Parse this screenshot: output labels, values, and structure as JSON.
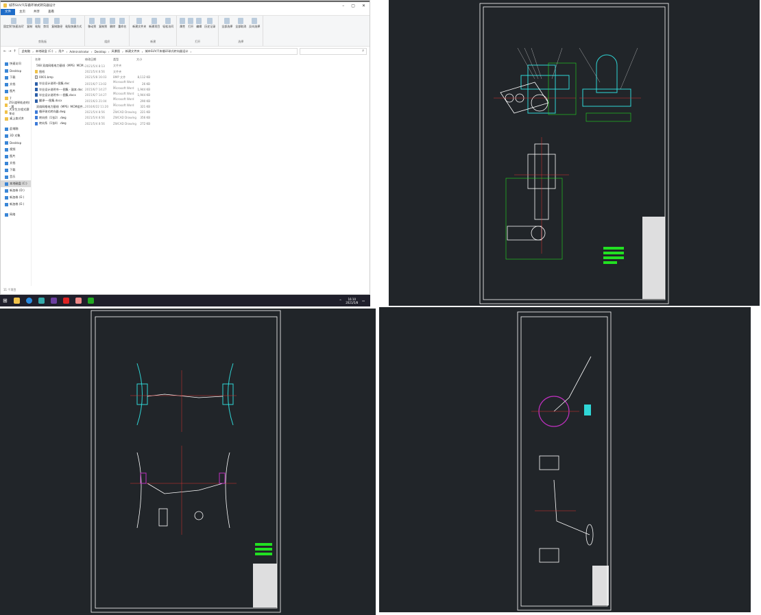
{
  "explorer": {
    "title": "城市SUV汽车循环球式转向器设计",
    "tabs": [
      "文件",
      "主页",
      "共享",
      "查看"
    ],
    "ribbon": {
      "groups": [
        {
          "label": "剪贴板",
          "items": [
            "固定到'快速访问'",
            "复制",
            "粘贴",
            "剪切",
            "复制路径",
            "粘贴快捷方式"
          ]
        },
        {
          "label": "组织",
          "items": [
            "移动到",
            "复制到",
            "删除",
            "重命名"
          ]
        },
        {
          "label": "新建",
          "items": [
            "新建文件夹",
            "新建项目",
            "轻松访问"
          ]
        },
        {
          "label": "打开",
          "items": [
            "属性",
            "打开",
            "编辑",
            "历史记录"
          ]
        },
        {
          "label": "选择",
          "items": [
            "全部选择",
            "全部取消",
            "反向选择"
          ]
        }
      ]
    },
    "breadcrumb": [
      "此电脑",
      "本地磁盘 (C:)",
      "用户",
      "Administrator",
      "Desktop",
      "风暴图",
      "新建文件夹",
      "城市SUV汽车循环球式转向器设计"
    ],
    "columns": [
      "名称",
      "修改日期",
      "类型",
      "大小"
    ],
    "files": [
      {
        "name": "568 双扇网格电力基线（MPS）MCM...",
        "date": "2021/5/4 8:13",
        "type": "文件夹",
        "size": "",
        "icon": "folder"
      },
      {
        "name": "图纸",
        "date": "2021/5/4 8:56",
        "type": "文件夹",
        "size": "",
        "icon": "folder"
      },
      {
        "name": "0001.bmp",
        "date": "2021/5/8 16:03",
        "type": "BMP 文件",
        "size": "8,112 KB",
        "icon": "bmp"
      },
      {
        "name": "毕业设计说明--图集.doc",
        "date": "2015/6/7 13:02",
        "type": "Microsoft Word ...",
        "size": "26 KB",
        "icon": "word"
      },
      {
        "name": "毕业设计说明书----图集 - 副本.doc",
        "date": "2015/6/7 14:27",
        "type": "Microsoft Word ...",
        "size": "1,944 KB",
        "icon": "word"
      },
      {
        "name": "毕业设计说明书----图集.docx",
        "date": "2015/6/7 14:27",
        "type": "Microsoft Word ...",
        "size": "1,944 KB",
        "icon": "word"
      },
      {
        "name": "翻译----图集.docx",
        "date": "2015/6/3 21:04",
        "type": "Microsoft Word ...",
        "size": "290 KB",
        "icon": "word"
      },
      {
        "name": "双扇网格电力基线（MPS）MCM组件...",
        "date": "2016/6/22 11:20",
        "type": "Microsoft Word ...",
        "size": "321 KB",
        "icon": "word"
      },
      {
        "name": "循环球式转向器.dwg",
        "date": "2021/5/4 8:56",
        "type": "ZWCAD Drawing",
        "size": "221 KB",
        "icon": "dwg"
      },
      {
        "name": "转向桥（1张2）.dwg",
        "date": "2021/5/4 8:56",
        "type": "ZWCAD Drawing",
        "size": "356 KB",
        "icon": "dwg"
      },
      {
        "name": "转向系（1张4）.dwg",
        "date": "2021/5/4 8:56",
        "type": "ZWCAD Drawing",
        "size": "272 KB",
        "icon": "dwg"
      }
    ],
    "nav": [
      {
        "label": "快速访问",
        "icon": "star"
      },
      {
        "label": "Desktop",
        "icon": "desktop"
      },
      {
        "label": "下载",
        "icon": "download"
      },
      {
        "label": "文档",
        "icon": "doc"
      },
      {
        "label": "图片",
        "icon": "picture"
      },
      {
        "label": "7",
        "icon": "folder"
      },
      {
        "label": "ZG(道琴轨迹的) - 满",
        "icon": "folder"
      },
      {
        "label": "大学生方程式赛车论",
        "icon": "folder"
      },
      {
        "label": "桌上查式木",
        "icon": "folder"
      },
      {
        "label": "此电脑",
        "icon": "pc"
      },
      {
        "label": "3D 对象",
        "icon": "3d"
      },
      {
        "label": "Desktop",
        "icon": "desktop"
      },
      {
        "label": "视频",
        "icon": "video"
      },
      {
        "label": "图片",
        "icon": "picture"
      },
      {
        "label": "文档",
        "icon": "doc"
      },
      {
        "label": "下载",
        "icon": "download"
      },
      {
        "label": "音乐",
        "icon": "music"
      },
      {
        "label": "本地磁盘 (C:)",
        "icon": "drive",
        "selected": true
      },
      {
        "label": "新加卷 (D:)",
        "icon": "drive"
      },
      {
        "label": "新加卷 (E:)",
        "icon": "drive"
      },
      {
        "label": "新加卷 (E:)",
        "icon": "drive"
      },
      {
        "label": "网络",
        "icon": "network"
      }
    ],
    "status": "11 个项目"
  },
  "taskbar": {
    "time": "16:10",
    "date": "2021/5/8"
  },
  "colors": {
    "cad_bg": "#212529",
    "cyan": "#2fd6d6",
    "red": "#e03030",
    "green": "#22e022",
    "magenta": "#c030c0",
    "white": "#ffffff",
    "accent": "#1e6cc8"
  }
}
